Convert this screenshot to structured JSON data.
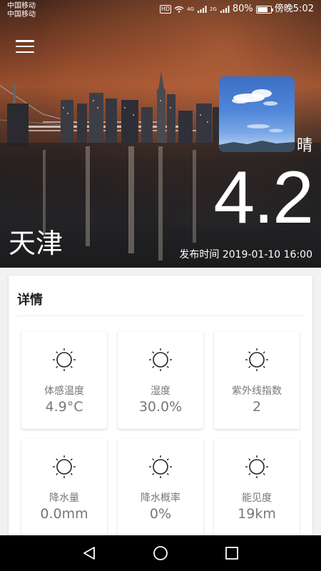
{
  "status_bar": {
    "carrier_1": "中国移动",
    "carrier_2": "中国移动",
    "hd": "HD",
    "network_1": "4G",
    "network_2": "2G",
    "battery": "80%",
    "battery_level": 0.8,
    "time": "傍晚5:02"
  },
  "hero": {
    "condition": "晴",
    "temperature": "4.2",
    "city": "天津",
    "publish_time": "发布时间 2019-01-10 16:00"
  },
  "details": {
    "title": "详情",
    "items": [
      {
        "label": "体感温度",
        "value": "4.9°C",
        "icon": "sun-icon"
      },
      {
        "label": "湿度",
        "value": "30.0%",
        "icon": "sun-icon"
      },
      {
        "label": "紫外线指数",
        "value": "2",
        "icon": "sun-icon"
      },
      {
        "label": "降水量",
        "value": "0.0mm",
        "icon": "sun-icon"
      },
      {
        "label": "降水概率",
        "value": "0%",
        "icon": "sun-icon"
      },
      {
        "label": "能见度",
        "value": "19km",
        "icon": "sun-icon"
      }
    ]
  },
  "nav": {
    "back": "back-icon",
    "home": "home-icon",
    "recents": "recents-icon"
  }
}
